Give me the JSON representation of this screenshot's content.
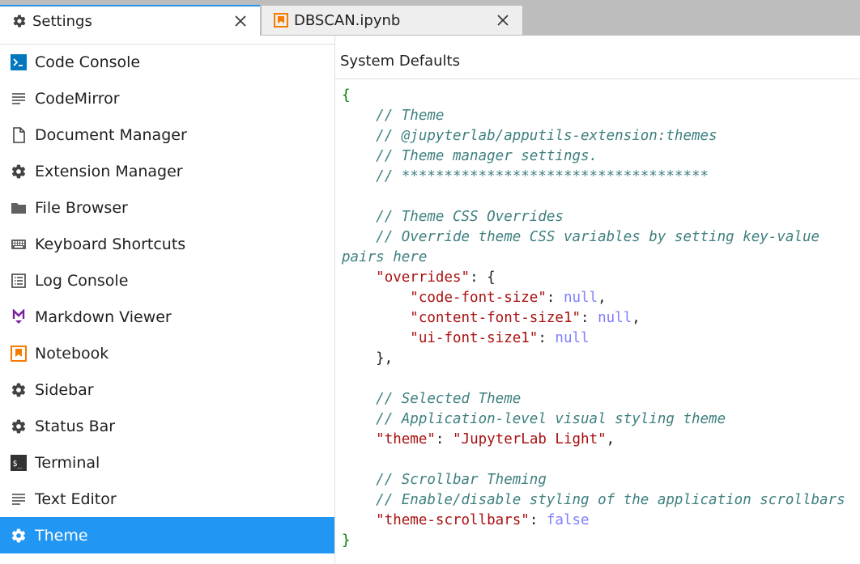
{
  "tabs": [
    {
      "label": "Settings",
      "icon": "gear-icon",
      "active": true
    },
    {
      "label": "DBSCAN.ipynb",
      "icon": "notebook-icon",
      "active": false
    }
  ],
  "sidebar": {
    "items": [
      {
        "label": "Code Console",
        "icon": "code-console-icon"
      },
      {
        "label": "CodeMirror",
        "icon": "text-lines-icon"
      },
      {
        "label": "Document Manager",
        "icon": "document-icon"
      },
      {
        "label": "Extension Manager",
        "icon": "gear-icon"
      },
      {
        "label": "File Browser",
        "icon": "folder-icon"
      },
      {
        "label": "Keyboard Shortcuts",
        "icon": "keyboard-icon"
      },
      {
        "label": "Log Console",
        "icon": "list-icon"
      },
      {
        "label": "Markdown Viewer",
        "icon": "markdown-icon"
      },
      {
        "label": "Notebook",
        "icon": "notebook-icon"
      },
      {
        "label": "Sidebar",
        "icon": "gear-icon"
      },
      {
        "label": "Status Bar",
        "icon": "gear-icon"
      },
      {
        "label": "Terminal",
        "icon": "terminal-icon"
      },
      {
        "label": "Text Editor",
        "icon": "text-lines-icon"
      },
      {
        "label": "Theme",
        "icon": "gear-icon",
        "selected": true
      }
    ]
  },
  "editor": {
    "header": "System Defaults",
    "lines": [
      [
        [
          "brace",
          "{"
        ]
      ],
      [
        [
          "punct",
          "    "
        ],
        [
          "comment",
          "// Theme"
        ]
      ],
      [
        [
          "punct",
          "    "
        ],
        [
          "comment",
          "// @jupyterlab/apputils-extension:themes"
        ]
      ],
      [
        [
          "punct",
          "    "
        ],
        [
          "comment",
          "// Theme manager settings."
        ]
      ],
      [
        [
          "punct",
          "    "
        ],
        [
          "comment",
          "// ************************************"
        ]
      ],
      [
        [
          "punct",
          ""
        ]
      ],
      [
        [
          "punct",
          "    "
        ],
        [
          "comment",
          "// Theme CSS Overrides"
        ]
      ],
      [
        [
          "punct",
          "    "
        ],
        [
          "comment",
          "// Override theme CSS variables by setting key-value"
        ]
      ],
      [
        [
          "comment",
          "pairs here"
        ]
      ],
      [
        [
          "punct",
          "    "
        ],
        [
          "key",
          "\"overrides\""
        ],
        [
          "punct",
          ": {"
        ]
      ],
      [
        [
          "punct",
          "        "
        ],
        [
          "key",
          "\"code-font-size\""
        ],
        [
          "punct",
          ": "
        ],
        [
          "kw",
          "null"
        ],
        [
          "punct",
          ","
        ]
      ],
      [
        [
          "punct",
          "        "
        ],
        [
          "key",
          "\"content-font-size1\""
        ],
        [
          "punct",
          ": "
        ],
        [
          "kw",
          "null"
        ],
        [
          "punct",
          ","
        ]
      ],
      [
        [
          "punct",
          "        "
        ],
        [
          "key",
          "\"ui-font-size1\""
        ],
        [
          "punct",
          ": "
        ],
        [
          "kw",
          "null"
        ]
      ],
      [
        [
          "punct",
          "    },"
        ]
      ],
      [
        [
          "punct",
          ""
        ]
      ],
      [
        [
          "punct",
          "    "
        ],
        [
          "comment",
          "// Selected Theme"
        ]
      ],
      [
        [
          "punct",
          "    "
        ],
        [
          "comment",
          "// Application-level visual styling theme"
        ]
      ],
      [
        [
          "punct",
          "    "
        ],
        [
          "key",
          "\"theme\""
        ],
        [
          "punct",
          ": "
        ],
        [
          "str",
          "\"JupyterLab Light\""
        ],
        [
          "punct",
          ","
        ]
      ],
      [
        [
          "punct",
          ""
        ]
      ],
      [
        [
          "punct",
          "    "
        ],
        [
          "comment",
          "// Scrollbar Theming"
        ]
      ],
      [
        [
          "punct",
          "    "
        ],
        [
          "comment",
          "// Enable/disable styling of the application scrollbars"
        ]
      ],
      [
        [
          "punct",
          "    "
        ],
        [
          "key",
          "\"theme-scrollbars\""
        ],
        [
          "punct",
          ": "
        ],
        [
          "kw",
          "false"
        ]
      ],
      [
        [
          "brace",
          "}"
        ]
      ]
    ]
  },
  "colors": {
    "accent": "#2196f3",
    "notebook_orange": "#f57c00",
    "markdown_purple": "#7b1fa2",
    "comment": "#408080",
    "string": "#aa1111",
    "keyword": "#7f7fff",
    "brace": "#008000"
  }
}
